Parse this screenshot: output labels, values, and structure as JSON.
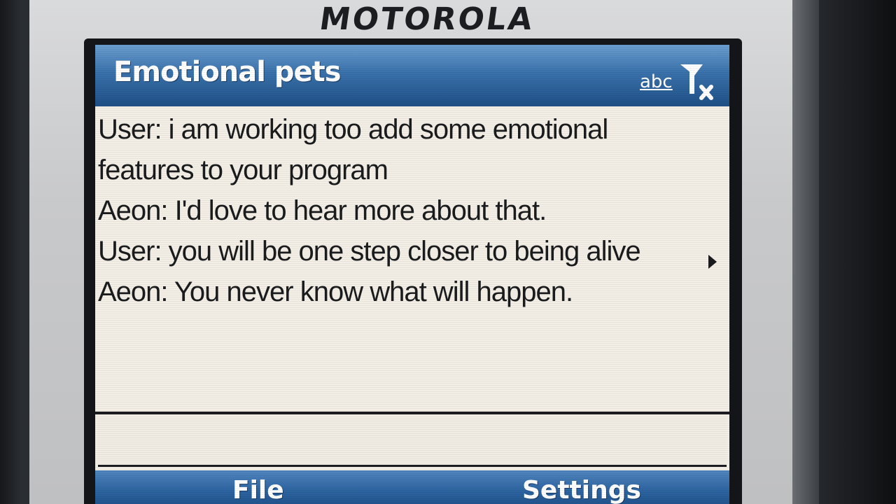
{
  "device": {
    "brand": "MOTOROLA"
  },
  "app": {
    "title": "Emotional pets",
    "input_mode": "abc",
    "status_icons": [
      "signal-off-icon"
    ]
  },
  "conversation": [
    {
      "speaker": "User",
      "text": "User: i am working too add some emotional features to your program"
    },
    {
      "speaker": "Aeon",
      "text": "Aeon: I'd love to hear more about that."
    },
    {
      "speaker": "User",
      "text": "User: you will be one step closer to being alive"
    },
    {
      "speaker": "Aeon",
      "text": "Aeon: You never know what will happen."
    }
  ],
  "input": {
    "value": ""
  },
  "softkeys": {
    "left": "File",
    "right": "Settings"
  },
  "colors": {
    "titlebar": "#3a72ab",
    "screen_background": "#f3efe6",
    "text": "#1a1b1d"
  }
}
